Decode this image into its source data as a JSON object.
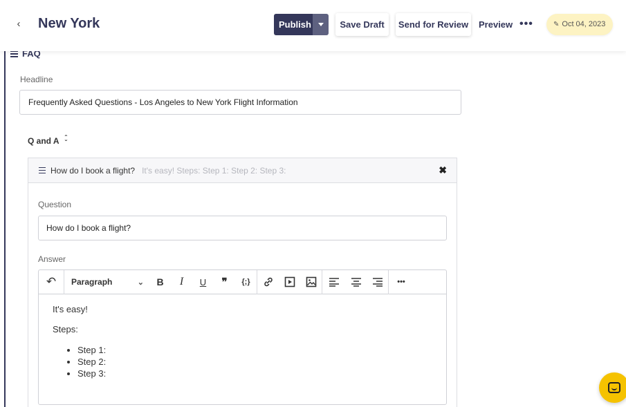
{
  "header": {
    "back_icon": "chevron-left-icon",
    "title": "New York",
    "publish_label": "Publish",
    "save_draft_label": "Save Draft",
    "send_review_label": "Send for Review",
    "preview_label": "Preview",
    "more_label": "•••",
    "date_label": "Oct 04, 2023",
    "date_color": "#fdf3c3",
    "accent": "#34375a"
  },
  "faq": {
    "section_title": "FAQ",
    "headline_label": "Headline",
    "headline_value": "Frequently Asked Questions - Los Angeles to New York Flight Information",
    "qa_label": "Q and A",
    "item": {
      "title": "How do I book a flight?",
      "preview": "It's easy! Steps: Step 1: Step 2: Step 3:",
      "question_label": "Question",
      "question_value": "How do I book a flight?",
      "answer_label": "Answer",
      "answer": {
        "paragraph_style": "Paragraph",
        "lines": [
          "It's easy!",
          "Steps:"
        ],
        "bullets": [
          "Step 1:",
          "Step 2:",
          "Step 3:"
        ]
      }
    }
  },
  "toolbar": {
    "undo": "↶",
    "bold": "B",
    "italic": "I",
    "underline": "U",
    "quote": "❞",
    "code": "{;}",
    "more": "•••"
  },
  "chat": {
    "icon": "chat-icon",
    "color": "#f5c200"
  }
}
